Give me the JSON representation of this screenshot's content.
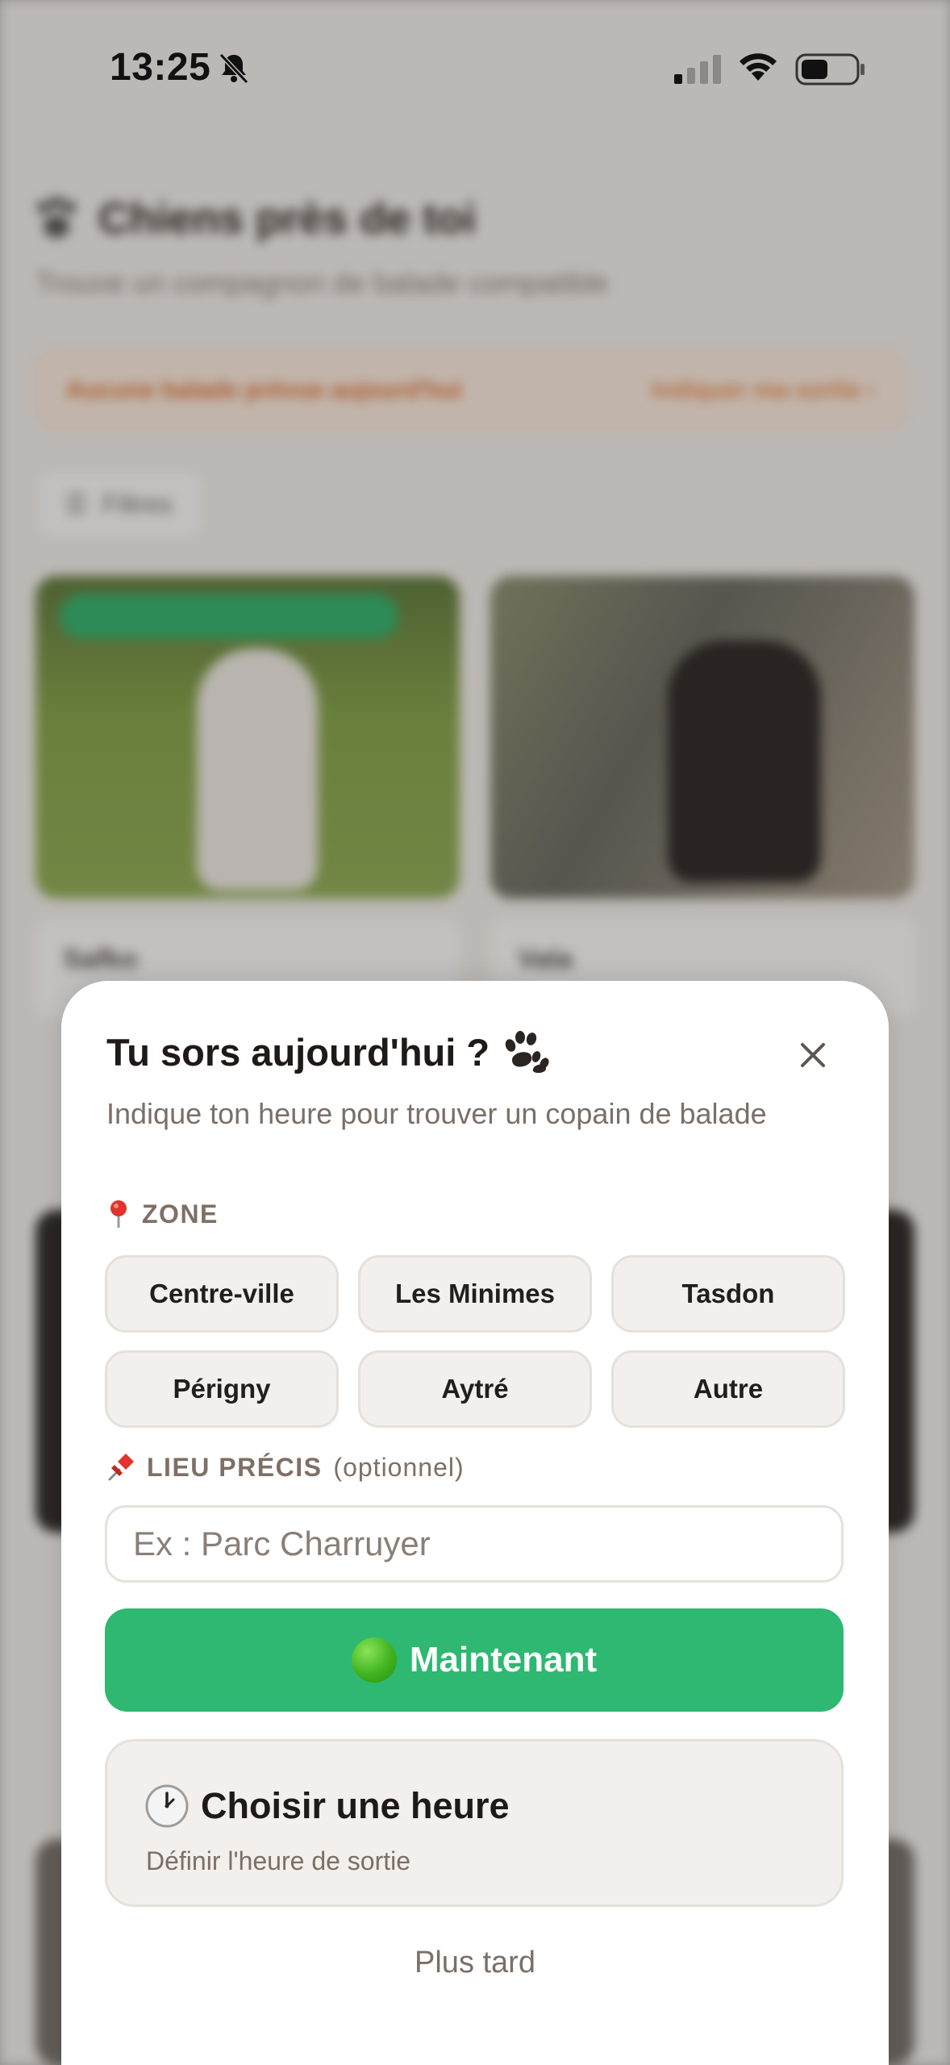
{
  "status_bar": {
    "time": "13:25"
  },
  "background": {
    "title": "Chiens près de toi",
    "subtitle": "Trouve un compagnon de balade compatible",
    "alert_text": "Aucune balade prévue aujourd'hui",
    "alert_action": "Indiquer ma sortie ›",
    "filter_label": "Filtres",
    "cards": [
      {
        "name": "Safko"
      },
      {
        "name": "Vala"
      }
    ]
  },
  "sheet": {
    "title": "Tu sors aujourd'hui ?",
    "subtitle": "Indique ton heure pour trouver un copain de balade",
    "zone_label": "ZONE",
    "zones": [
      "Centre-ville",
      "Les Minimes",
      "Tasdon",
      "Périgny",
      "Aytré",
      "Autre"
    ],
    "place_label": "LIEU PRÉCIS",
    "place_optional": "(optionnel)",
    "place_value": "",
    "place_placeholder": "Ex : Parc Charruyer",
    "now_button": "Maintenant",
    "choose_title": "Choisir une heure",
    "choose_subtitle": "Définir l'heure de sortie",
    "later": "Plus tard"
  },
  "colors": {
    "accent_green": "#2eb872",
    "chip_bg": "#f2efec",
    "muted_text": "#7b6f67"
  },
  "icons": [
    "bell-muted-icon",
    "signal-icon",
    "wifi-icon",
    "battery-icon",
    "paw-icon",
    "close-icon",
    "pin-icon",
    "pushpin-icon",
    "green-circle-icon",
    "clock-icon"
  ]
}
